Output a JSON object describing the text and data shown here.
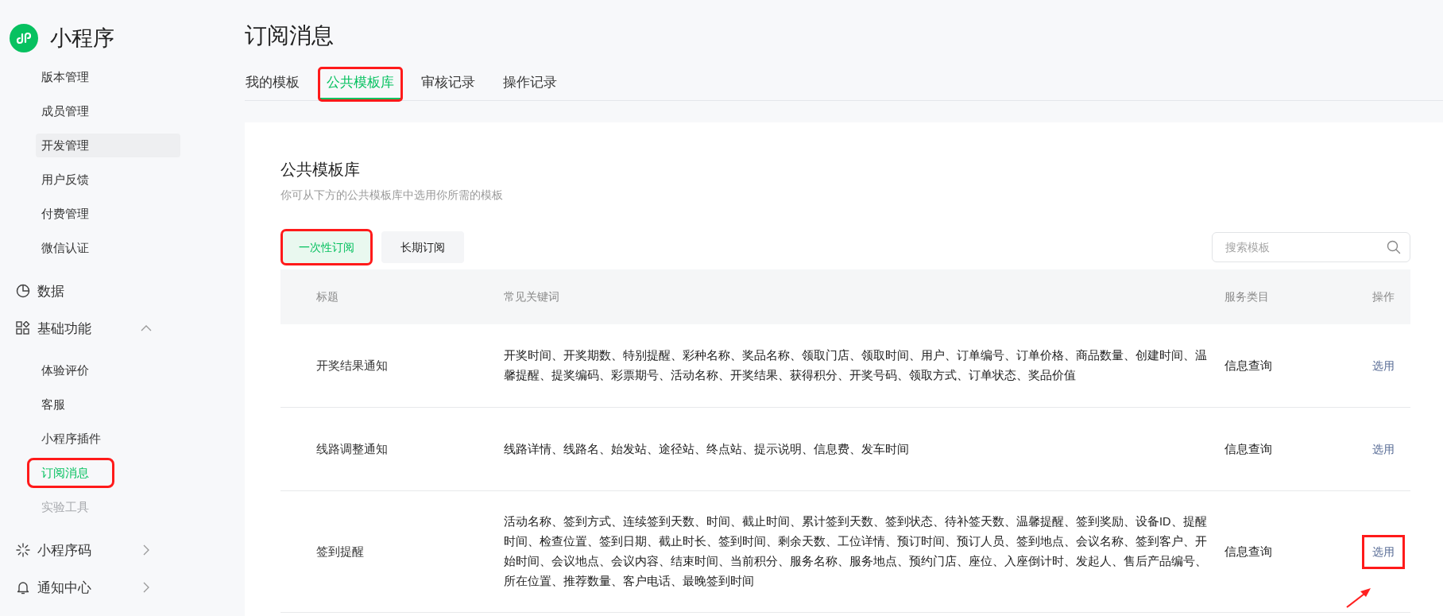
{
  "app": {
    "name": "小程序"
  },
  "sidebar": {
    "top_items": [
      {
        "label": "版本管理",
        "selected": false,
        "hovered": false,
        "highlighted": false,
        "faded": false
      },
      {
        "label": "成员管理",
        "selected": false,
        "hovered": false,
        "highlighted": false,
        "faded": false
      },
      {
        "label": "开发管理",
        "selected": false,
        "hovered": true,
        "highlighted": false,
        "faded": false
      },
      {
        "label": "用户反馈",
        "selected": false,
        "hovered": false,
        "highlighted": false,
        "faded": false
      },
      {
        "label": "付费管理",
        "selected": false,
        "hovered": false,
        "highlighted": false,
        "faded": false
      },
      {
        "label": "微信认证",
        "selected": false,
        "hovered": false,
        "highlighted": false,
        "faded": false
      }
    ],
    "sections": [
      {
        "kind": "link",
        "label": "数据"
      },
      {
        "kind": "group",
        "label": "基础功能",
        "expanded": true,
        "children": [
          {
            "label": "体验评价",
            "selected": false,
            "hovered": false,
            "highlighted": false,
            "faded": false
          },
          {
            "label": "客服",
            "selected": false,
            "hovered": false,
            "highlighted": false,
            "faded": false
          },
          {
            "label": "小程序插件",
            "selected": false,
            "hovered": false,
            "highlighted": false,
            "faded": false
          },
          {
            "label": "订阅消息",
            "selected": true,
            "hovered": false,
            "highlighted": true,
            "faded": false
          },
          {
            "label": "实验工具",
            "selected": false,
            "hovered": false,
            "highlighted": false,
            "faded": true
          }
        ]
      },
      {
        "kind": "group",
        "label": "小程序码",
        "expanded": false
      },
      {
        "kind": "group",
        "label": "通知中心",
        "expanded": false
      }
    ]
  },
  "page": {
    "title": "订阅消息",
    "tabs": [
      {
        "label": "我的模板",
        "selected": false,
        "highlighted": false
      },
      {
        "label": "公共模板库",
        "selected": true,
        "highlighted": true
      },
      {
        "label": "审核记录",
        "selected": false,
        "highlighted": false
      },
      {
        "label": "操作记录",
        "selected": false,
        "highlighted": false
      }
    ]
  },
  "library": {
    "title": "公共模板库",
    "description": "你可从下方的公共模板库中选用你所需的模板",
    "segments": [
      {
        "label": "一次性订阅",
        "selected": true,
        "highlighted": true
      },
      {
        "label": "长期订阅",
        "selected": false,
        "highlighted": false
      }
    ],
    "search": {
      "placeholder": "搜索模板"
    },
    "table": {
      "columns": [
        "标题",
        "常见关键词",
        "服务类目",
        "操作"
      ],
      "rows": [
        {
          "title": "开奖结果通知",
          "keywords": "开奖时间、开奖期数、特别提醒、彩种名称、奖品名称、领取门店、领取时间、用户、订单编号、订单价格、商品数量、创建时间、温馨提醒、提奖编码、彩票期号、活动名称、开奖结果、获得积分、开奖号码、领取方式、订单状态、奖品价值",
          "category": "信息查询",
          "action": {
            "label": "选用",
            "highlighted": false,
            "arrow": false
          }
        },
        {
          "title": "线路调整通知",
          "keywords": "线路详情、线路名、始发站、途径站、终点站、提示说明、信息费、发车时间",
          "category": "信息查询",
          "action": {
            "label": "选用",
            "highlighted": false,
            "arrow": false
          }
        },
        {
          "title": "签到提醒",
          "keywords": "活动名称、签到方式、连续签到天数、时间、截止时间、累计签到天数、签到状态、待补签天数、温馨提醒、签到奖励、设备ID、提醒时间、检查位置、签到日期、截止时长、签到时间、剩余天数、工位详情、预订时间、预订人员、签到地点、会议名称、签到客户、开始时间、会议地点、会议内容、结束时间、当前积分、服务名称、服务地点、预约门店、座位、入座倒计时、发起人、售后产品编号、所在位置、推荐数量、客户电话、最晚签到时间",
          "category": "信息查询",
          "action": {
            "label": "选用",
            "highlighted": true,
            "arrow": true
          }
        }
      ]
    }
  }
}
